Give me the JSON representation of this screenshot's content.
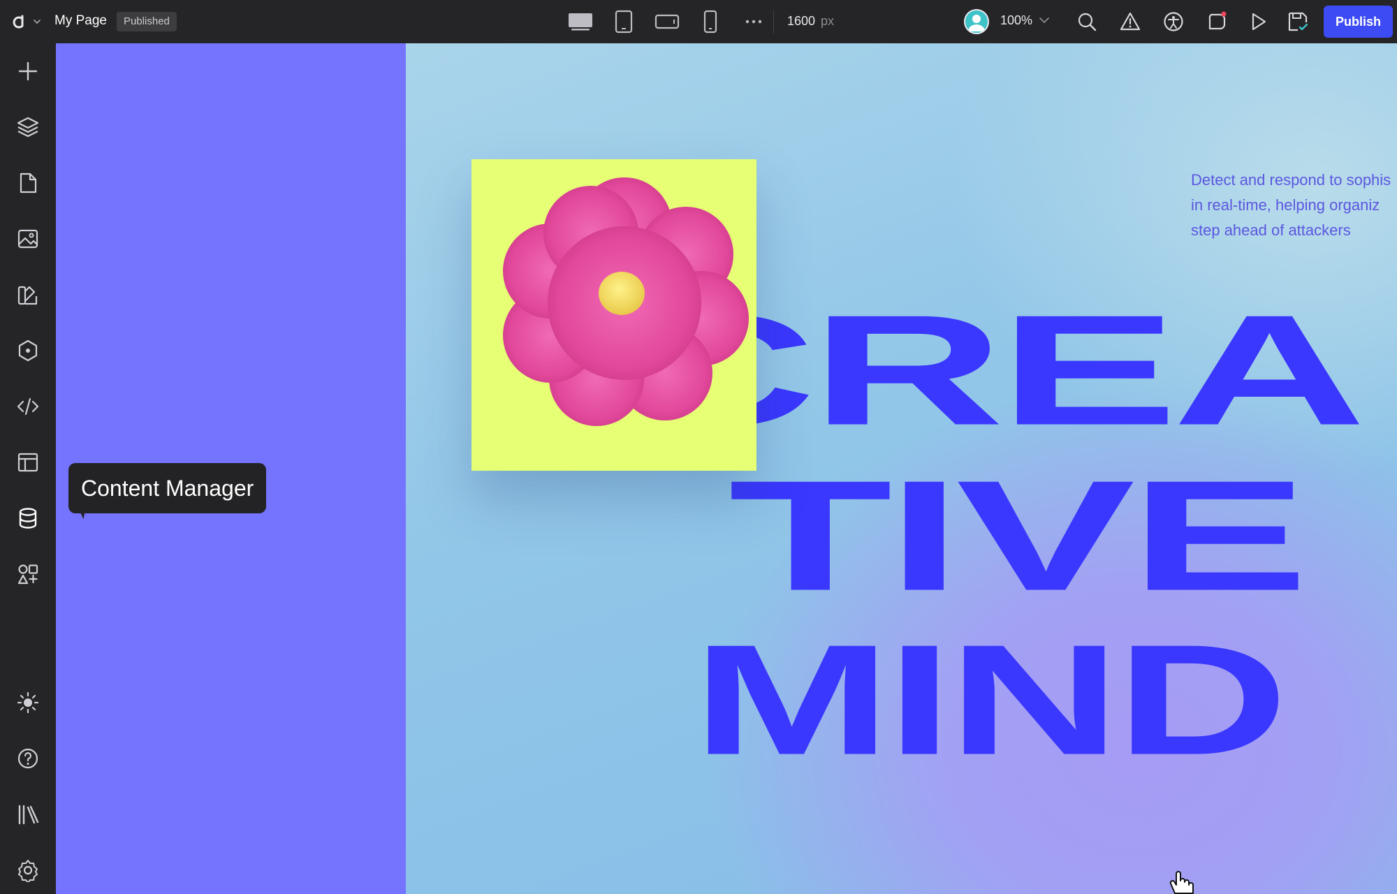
{
  "app": {
    "title": "My Page",
    "status": "Published",
    "canvas_width": "1600",
    "canvas_unit": "px",
    "zoom": "100%",
    "publish_label": "Publish"
  },
  "colors": {
    "accent": "#3d4bf5",
    "panel": "#7574ff",
    "headline": "#3a37ff",
    "card": "#e6ff75",
    "flower": "#e2489b"
  },
  "devices": [
    "desktop-icon",
    "tablet-icon",
    "tablet-landscape-icon",
    "mobile-icon",
    "more-icon"
  ],
  "toolbar_icons": [
    "search-icon",
    "warning-icon",
    "accessibility-icon",
    "comments-icon",
    "preview-play-icon",
    "save-icon"
  ],
  "sidebar": {
    "items": [
      {
        "icon": "add-icon"
      },
      {
        "icon": "layers-icon"
      },
      {
        "icon": "pages-icon"
      },
      {
        "icon": "media-icon"
      },
      {
        "icon": "styles-icon"
      },
      {
        "icon": "components-icon"
      },
      {
        "icon": "code-icon"
      },
      {
        "icon": "templates-icon"
      },
      {
        "icon": "database-icon",
        "tooltip": "Content Manager"
      },
      {
        "icon": "apps-icon"
      },
      {
        "icon": "theme-sun-icon"
      },
      {
        "icon": "help-icon"
      },
      {
        "icon": "library-icon"
      },
      {
        "icon": "settings-icon"
      }
    ]
  },
  "hero": {
    "description_lines": [
      "Detect and respond to sophis",
      "in real-time, helping organiz",
      "step ahead of attackers"
    ],
    "headline": [
      "CREA",
      "TIVE",
      "MIND"
    ]
  }
}
